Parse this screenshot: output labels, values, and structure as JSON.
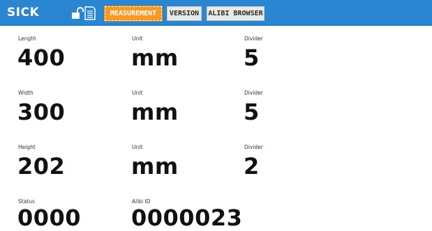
{
  "header": {
    "logo": "SICK",
    "lock_icon": "unlocked-padlock-icon",
    "card_icon": "sd-card-icon",
    "tabs": [
      {
        "label": "MEASUREMENT",
        "active": true
      },
      {
        "label": "VERSION",
        "active": false
      },
      {
        "label": "ALIBI BROWSER",
        "active": false
      }
    ]
  },
  "colors": {
    "topbar": "#2a86d1",
    "active_tab": "#f39a27",
    "inactive_tab": "#e9e9e9"
  },
  "measurements": [
    {
      "label": "Length",
      "value": "400",
      "unit_label": "Unit",
      "unit": "mm",
      "divider_label": "Divider",
      "divider": "5"
    },
    {
      "label": "Width",
      "value": "300",
      "unit_label": "Unit",
      "unit": "mm",
      "divider_label": "Divider",
      "divider": "5"
    },
    {
      "label": "Height",
      "value": "202",
      "unit_label": "Unit",
      "unit": "mm",
      "divider_label": "Divider",
      "divider": "2"
    }
  ],
  "status": {
    "label": "Status",
    "value": "0000"
  },
  "alibi": {
    "label": "Alibi ID",
    "value": "0000023"
  }
}
